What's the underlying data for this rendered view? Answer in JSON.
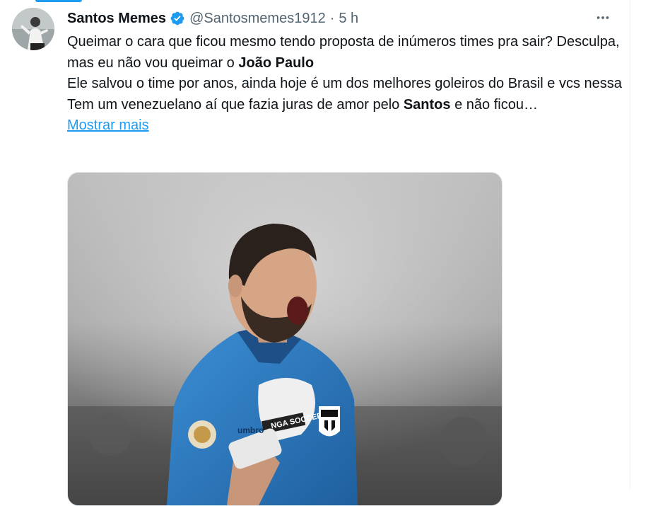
{
  "tweet": {
    "author": {
      "display_name": "Santos Memes",
      "handle": "@Santosmemes1912",
      "verified": true,
      "avatar_icon": "avatar-photo"
    },
    "separator": "·",
    "time": "5 h",
    "more_icon": "more-horizontal-icon",
    "body": {
      "line1": "Queimar o cara que ficou mesmo tendo proposta de inúmeros times pra sair? Desculpa, mas eu não vou queimar o ",
      "line1_bold": "João Paulo",
      "line2": "Ele salvou o time por anos, ainda hoje é um dos melhores goleiros do Brasil e vcs nessa",
      "line3_pre": "Tem um venezuelano aí que fazia juras de amor pelo ",
      "line3_bold": "Santos",
      "line3_post": " e não ficou…"
    },
    "show_more_label": "Mostrar mais",
    "media": {
      "description_kind": "photo",
      "glove_brand": "NGA SOCCER",
      "kit_brand": "umbro"
    }
  },
  "colors": {
    "accent": "#1d9bf0",
    "secondary_text": "#536471",
    "primary_text": "#0f1419",
    "jersey": "#2f7fc9"
  }
}
